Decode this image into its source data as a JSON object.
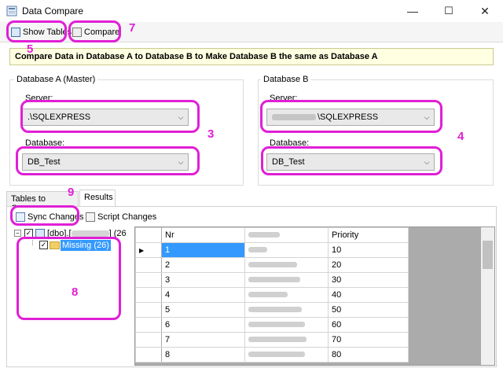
{
  "window": {
    "title": "Data Compare",
    "controls": {
      "minimize": "—",
      "maximize": "☐",
      "close": "✕"
    }
  },
  "toolbar": {
    "show_tables": "Show Tables",
    "compare": "Compare"
  },
  "banner": "Compare Data in Database A to Database B to Make Database B the same as Database A",
  "database_a": {
    "title": "Database A (Master)",
    "server_label": "Server:",
    "server_value": ".\\SQLEXPRESS",
    "database_label": "Database:",
    "database_value": "DB_Test"
  },
  "database_b": {
    "title": "Database B",
    "server_label": "Server:",
    "server_value": "\\SQLEXPRESS",
    "database_label": "Database:",
    "database_value": "DB_Test"
  },
  "tabs": [
    "Tables to Compare",
    "Results"
  ],
  "results_toolbar": {
    "sync_changes": "Sync Changes",
    "script_changes": "Script Changes"
  },
  "tree": {
    "root_prefix": "[dbo].[",
    "root_suffix": "] (26",
    "child_label": "Missing (26)"
  },
  "grid": {
    "columns": [
      "Nr",
      "",
      "Priority"
    ],
    "rows": [
      {
        "nr": "1",
        "priority": "10"
      },
      {
        "nr": "2",
        "priority": "20"
      },
      {
        "nr": "3",
        "priority": "30"
      },
      {
        "nr": "4",
        "priority": "40"
      },
      {
        "nr": "5",
        "priority": "50"
      },
      {
        "nr": "6",
        "priority": "60"
      },
      {
        "nr": "7",
        "priority": "70"
      },
      {
        "nr": "8",
        "priority": "80"
      }
    ],
    "row_pointer": "▶"
  },
  "annotations": [
    "3",
    "4",
    "5",
    "7",
    "8",
    "9"
  ],
  "colors": {
    "annotation": "#e01fd6",
    "selection": "#3399ff",
    "banner": "#ffffe1"
  }
}
